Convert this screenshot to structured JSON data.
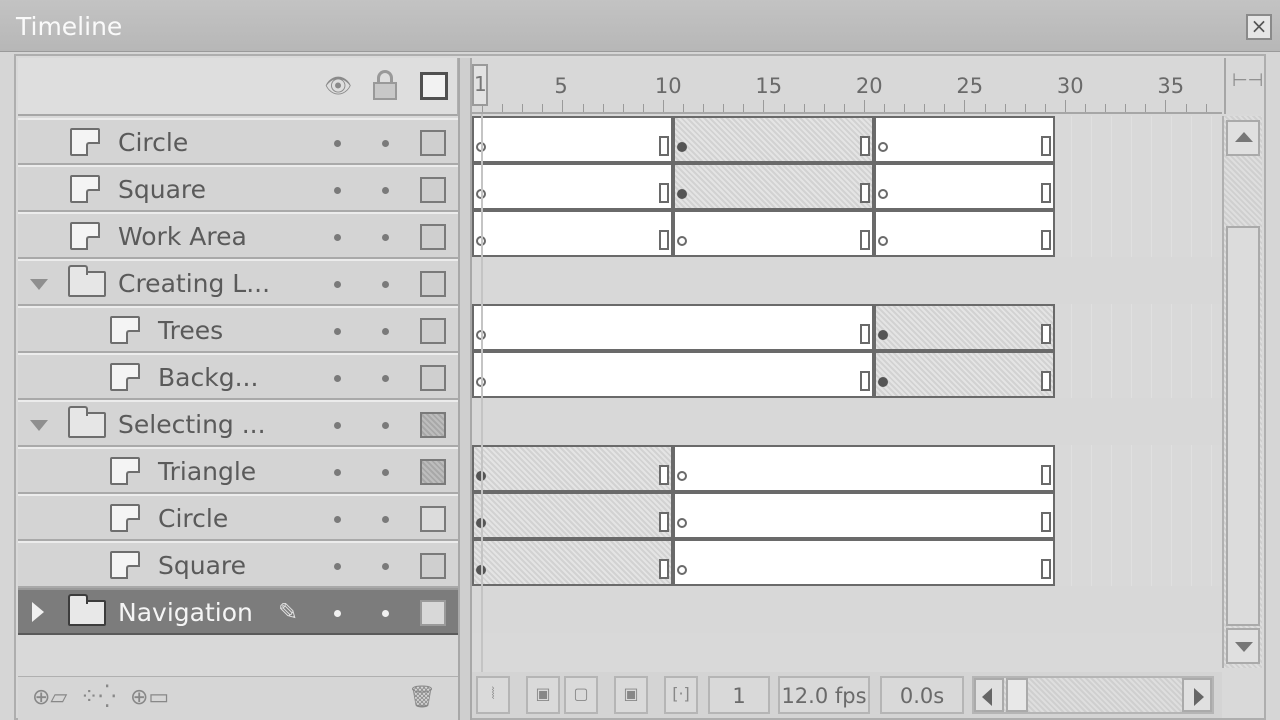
{
  "window": {
    "title": "Timeline",
    "close_label": "×"
  },
  "layers_header": {
    "eye_icon": "eye-icon",
    "lock_icon": "lock-icon",
    "outline_icon": "outline-icon"
  },
  "layers": [
    {
      "name": "Circle",
      "type": "layer",
      "indent": 1,
      "outline": "filled",
      "selected": false
    },
    {
      "name": "Square",
      "type": "layer",
      "indent": 1,
      "outline": "filled",
      "selected": false
    },
    {
      "name": "Work Area",
      "type": "layer",
      "indent": 1,
      "outline": "filled",
      "selected": false
    },
    {
      "name": "Creating L...",
      "type": "folder",
      "expanded": true,
      "indent": 0,
      "outline": "filled",
      "selected": false
    },
    {
      "name": "Trees",
      "type": "layer",
      "indent": 2,
      "outline": "filled",
      "selected": false
    },
    {
      "name": "Backg...",
      "type": "layer",
      "indent": 2,
      "outline": "filled",
      "selected": false
    },
    {
      "name": "Selecting ...",
      "type": "folder",
      "expanded": true,
      "indent": 0,
      "outline": "hatched",
      "selected": false
    },
    {
      "name": "Triangle",
      "type": "layer",
      "indent": 2,
      "outline": "hatched",
      "selected": false
    },
    {
      "name": "Circle",
      "type": "layer",
      "indent": 2,
      "outline": "empty",
      "selected": false
    },
    {
      "name": "Square",
      "type": "layer",
      "indent": 2,
      "outline": "filled",
      "selected": false
    },
    {
      "name": "Navigation",
      "type": "folder",
      "expanded": false,
      "indent": 0,
      "outline": "filled",
      "selected": true
    }
  ],
  "ruler": {
    "labels": [
      "1",
      "5",
      "10",
      "15",
      "20",
      "25",
      "30",
      "35"
    ],
    "current_frame": "1"
  },
  "frame_rows": [
    {
      "segments": [
        {
          "from": 1,
          "to": 10,
          "start_key": "empty",
          "fill": "white"
        },
        {
          "from": 11,
          "to": 20,
          "start_key": "filled",
          "fill": "tween"
        },
        {
          "from": 21,
          "to": 29,
          "start_key": "empty",
          "fill": "white"
        }
      ]
    },
    {
      "segments": [
        {
          "from": 1,
          "to": 10,
          "start_key": "empty",
          "fill": "white"
        },
        {
          "from": 11,
          "to": 20,
          "start_key": "filled",
          "fill": "tween"
        },
        {
          "from": 21,
          "to": 29,
          "start_key": "empty",
          "fill": "white"
        }
      ]
    },
    {
      "segments": [
        {
          "from": 1,
          "to": 10,
          "start_key": "empty",
          "fill": "white"
        },
        {
          "from": 11,
          "to": 20,
          "start_key": "empty",
          "fill": "white"
        },
        {
          "from": 21,
          "to": 29,
          "start_key": "empty",
          "fill": "white"
        }
      ]
    },
    {
      "segments": []
    },
    {
      "segments": [
        {
          "from": 1,
          "to": 20,
          "start_key": "empty",
          "fill": "white"
        },
        {
          "from": 21,
          "to": 29,
          "start_key": "filled",
          "fill": "tween"
        }
      ]
    },
    {
      "segments": [
        {
          "from": 1,
          "to": 20,
          "start_key": "empty",
          "fill": "white"
        },
        {
          "from": 21,
          "to": 29,
          "start_key": "filled",
          "fill": "tween"
        }
      ]
    },
    {
      "segments": []
    },
    {
      "segments": [
        {
          "from": 1,
          "to": 10,
          "start_key": "filled",
          "fill": "tween"
        },
        {
          "from": 11,
          "to": 29,
          "start_key": "empty",
          "fill": "white"
        }
      ]
    },
    {
      "segments": [
        {
          "from": 1,
          "to": 10,
          "start_key": "filled",
          "fill": "tween"
        },
        {
          "from": 11,
          "to": 29,
          "start_key": "empty",
          "fill": "white"
        }
      ]
    },
    {
      "segments": [
        {
          "from": 1,
          "to": 10,
          "start_key": "filled",
          "fill": "tween"
        },
        {
          "from": 11,
          "to": 29,
          "start_key": "empty",
          "fill": "white"
        }
      ]
    },
    {
      "segments": []
    }
  ],
  "status": {
    "current_frame": "1",
    "frame_rate": "12.0 fps",
    "elapsed_time": "0.0s"
  },
  "footer": {
    "insert_layer_icon": "insert-layer-icon",
    "add_guide_icon": "add-motion-guide-icon",
    "insert_folder_icon": "insert-folder-icon",
    "delete_icon": "trash-icon"
  }
}
